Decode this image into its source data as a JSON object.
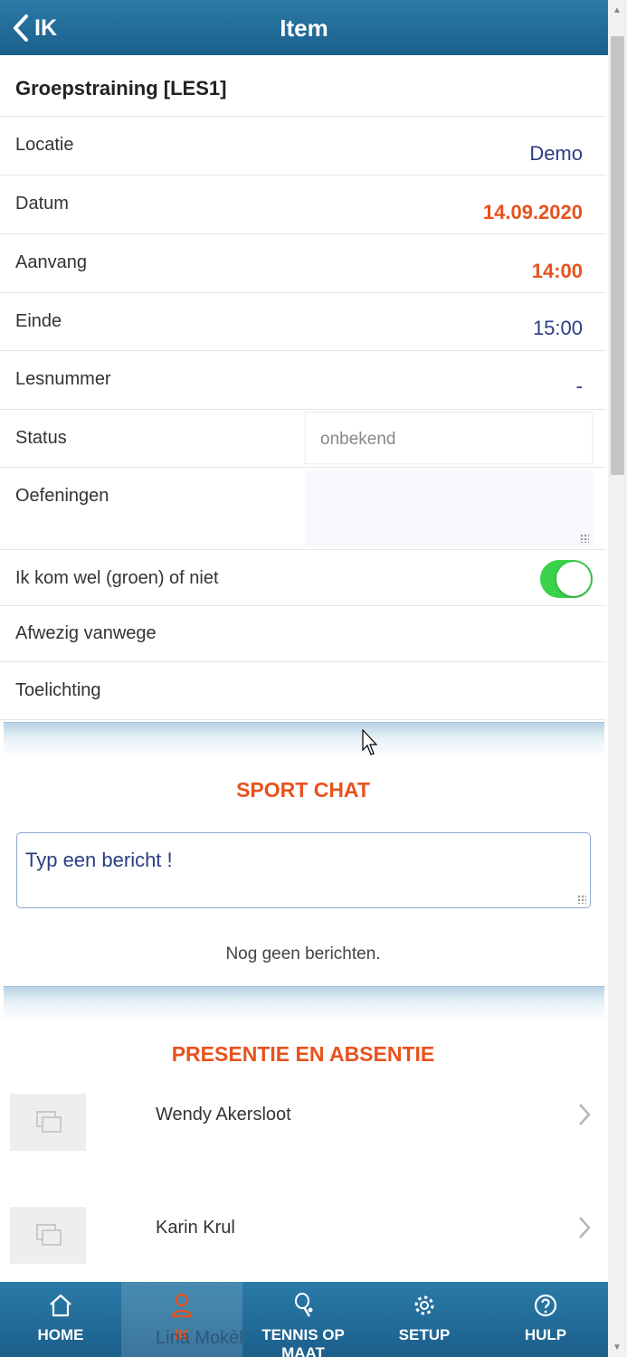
{
  "header": {
    "back_label": "IK",
    "title": "Item"
  },
  "item_title": "Groepstraining [LES1]",
  "fields": {
    "locatie": {
      "label": "Locatie",
      "value": "Demo"
    },
    "datum": {
      "label": "Datum",
      "value": "14.09.2020"
    },
    "aanvang": {
      "label": "Aanvang",
      "value": "14:00"
    },
    "einde": {
      "label": "Einde",
      "value": "15:00"
    },
    "lesnummer": {
      "label": "Lesnummer",
      "value": "-"
    },
    "status": {
      "label": "Status",
      "value": "onbekend"
    },
    "oefeningen": {
      "label": "Oefeningen",
      "value": ""
    },
    "attendance": {
      "label": "Ik kom wel (groen) of niet",
      "on": true
    },
    "afwezig": {
      "label": "Afwezig vanwege"
    },
    "toelichting": {
      "label": "Toelichting"
    }
  },
  "chat": {
    "title": "SPORT CHAT",
    "placeholder": "Typ een bericht !",
    "empty_text": "Nog geen berichten."
  },
  "presence": {
    "title": "PRESENTIE EN ABSENTIE",
    "people": [
      "Wendy Akersloot",
      "Karin Krul",
      "Lina Mokèl"
    ]
  },
  "tabbar": {
    "tabs": [
      {
        "label": "HOME",
        "icon": "home-icon"
      },
      {
        "label": "IK",
        "icon": "person-icon",
        "active": true
      },
      {
        "label": "TENNIS OP MAAT",
        "icon": "tennis-racket-icon"
      },
      {
        "label": "SETUP",
        "icon": "gear-icon"
      },
      {
        "label": "HULP",
        "icon": "help-circle-icon"
      }
    ]
  },
  "colors": {
    "accent": "#e8521d",
    "header_blue": "#1b5f8c",
    "value_blue": "#2a3d85",
    "toggle_green": "#3ad24a"
  }
}
